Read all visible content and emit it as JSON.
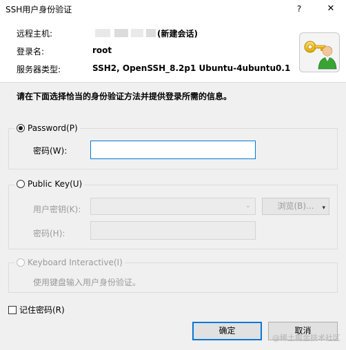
{
  "window": {
    "title": "SSH用户身份验证",
    "help_label": "?",
    "close_label": "✕"
  },
  "header": {
    "remote_host_label": "远程主机:",
    "remote_host_suffix": "(新建会话)",
    "login_name_label": "登录名:",
    "login_name_value": "root",
    "server_type_label": "服务器类型:",
    "server_type_value": "SSH2, OpenSSH_8.2p1 Ubuntu-4ubuntu0.1"
  },
  "instruction": "请在下面选择恰当的身份验证方法并提供登录所需的信息。",
  "password_group": {
    "label": "Password(P)",
    "selected": true,
    "field_label": "密码(W):",
    "field_value": ""
  },
  "publickey_group": {
    "label": "Public Key(U)",
    "selected": false,
    "key_label": "用户密钥(K):",
    "key_value": "",
    "browse_label": "浏览(B)...",
    "passphrase_label": "密码(H):",
    "passphrase_value": ""
  },
  "keyboard_group": {
    "label": "Keyboard Interactive(I)",
    "selected": false,
    "description": "使用键盘输入用户身份验证。"
  },
  "remember": {
    "label": "记住密码(R)",
    "checked": false
  },
  "buttons": {
    "ok_label": "确定",
    "cancel_label": "取消"
  },
  "watermark": "@稀土掘金技术社区",
  "icons": [
    "help-icon",
    "close-icon",
    "user-key-icon",
    "dropdown-arrow-icon",
    "browse-dropdown-arrow-icon"
  ]
}
